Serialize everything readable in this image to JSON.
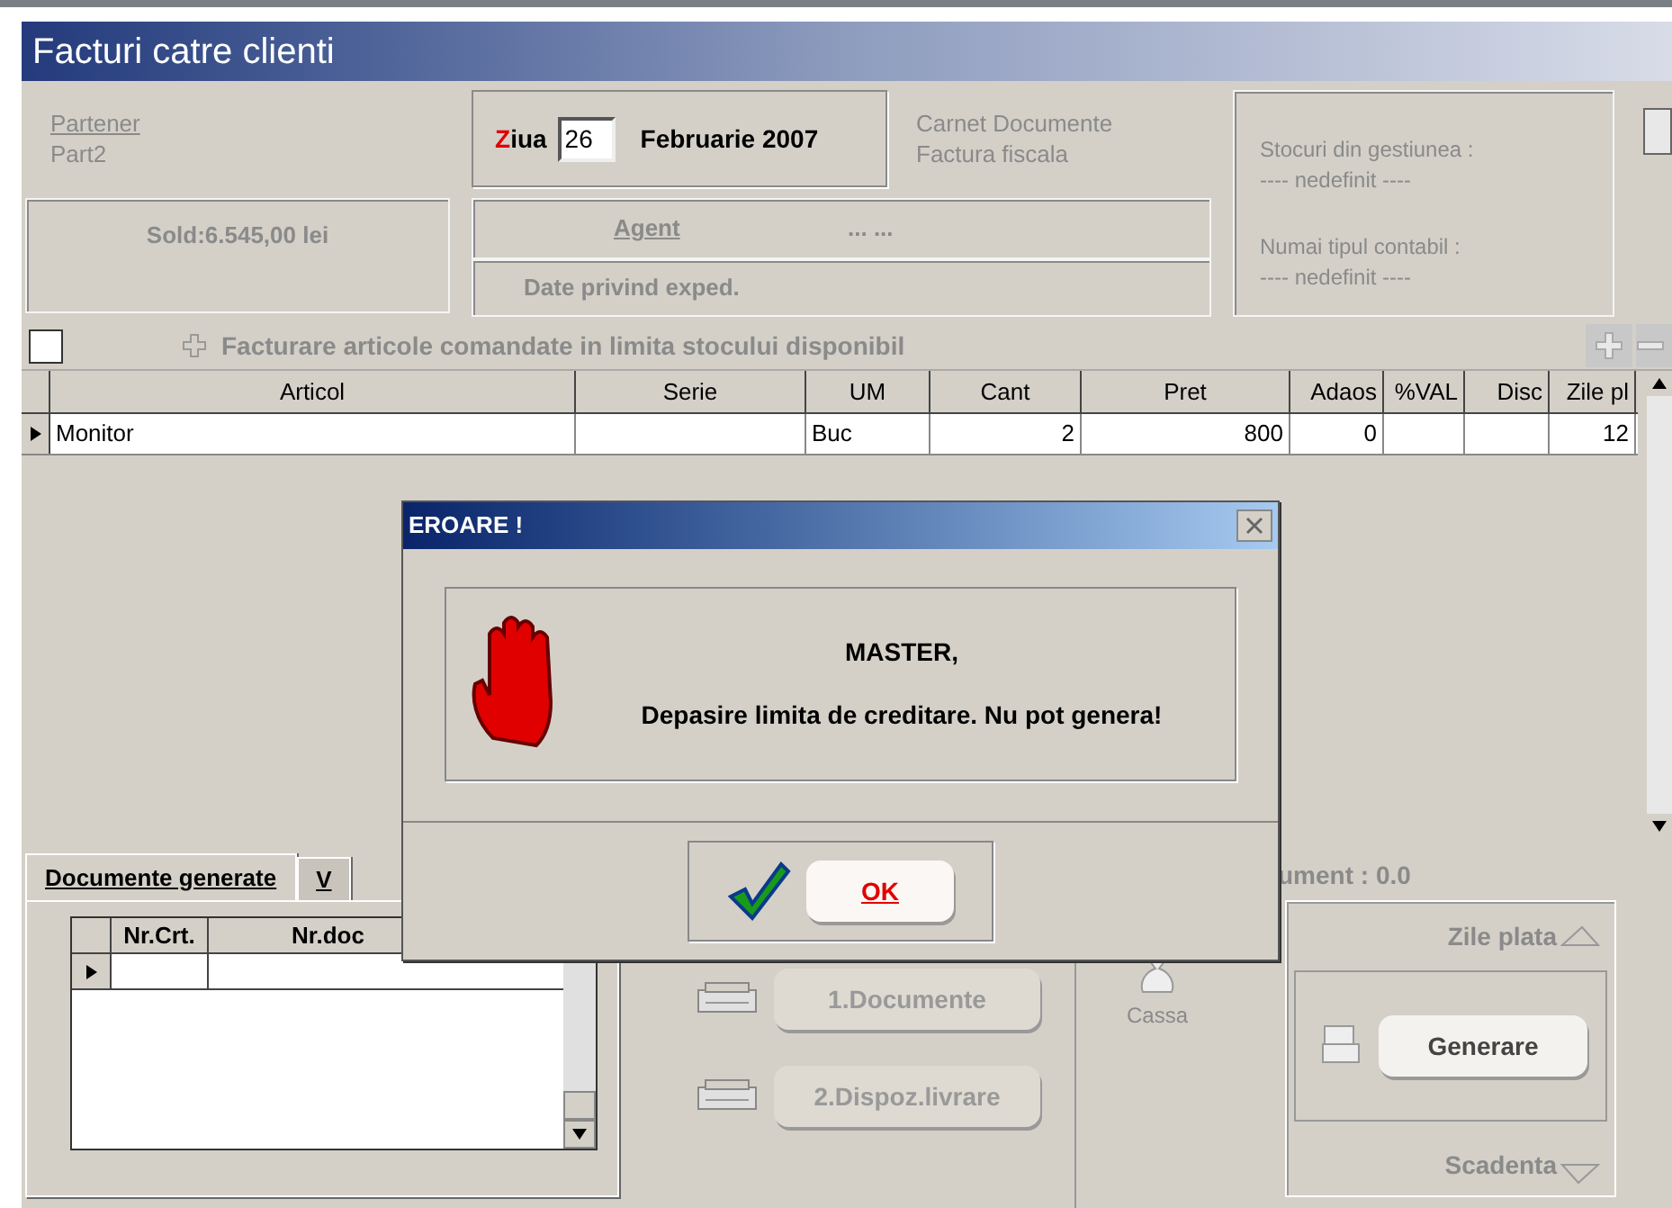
{
  "window": {
    "title": "Facturi catre clienti"
  },
  "partner": {
    "label": "Partener",
    "value": "Part2"
  },
  "date": {
    "label_first": "Z",
    "label_rest": "iua",
    "day": "26",
    "month_year": "Februarie 2007"
  },
  "carnet": {
    "label": "Carnet Documente",
    "value": "Factura fiscala"
  },
  "sold": "Sold:6.545,00 lei",
  "agent": {
    "label": "Agent",
    "value": "... ..."
  },
  "shipping": "Date privind exped.",
  "stock": [
    {
      "label": "Stocuri din gestiunea :",
      "value": "---- nedefinit ----"
    },
    {
      "label": "Numai tipul contabil :",
      "value": "---- nedefinit ----"
    }
  ],
  "stock_limit": {
    "checked": false,
    "label": "Facturare articole comandate in limita stocului disponibil"
  },
  "table": {
    "columns": [
      "Articol",
      "Serie",
      "UM",
      "Cant",
      "Pret",
      "Adaos",
      "%VAL",
      "Disc",
      "Zile pl"
    ],
    "rows": [
      {
        "selected": true,
        "cells": [
          "Monitor",
          "",
          "Buc",
          "2",
          "800",
          "0",
          "",
          "",
          "12"
        ]
      }
    ]
  },
  "bottom": {
    "tabs": [
      {
        "label": "Documente generate",
        "selected": true
      },
      {
        "label": "V",
        "selected": false
      }
    ],
    "doc_columns": [
      "Nr.Crt.",
      "Nr.doc"
    ],
    "buttons": [
      "1.Documente",
      "2.Dispoz.livrare"
    ],
    "cassa": "Cassa",
    "document_total": "ument : 0.0",
    "zile_plata": "Zile plata",
    "generate": "Generare",
    "scadenta": "Scadenta"
  },
  "dialog": {
    "title": "EROARE !",
    "heading": "MASTER,",
    "message": "Depasire limita de creditare. Nu pot genera!",
    "ok": "OK"
  }
}
